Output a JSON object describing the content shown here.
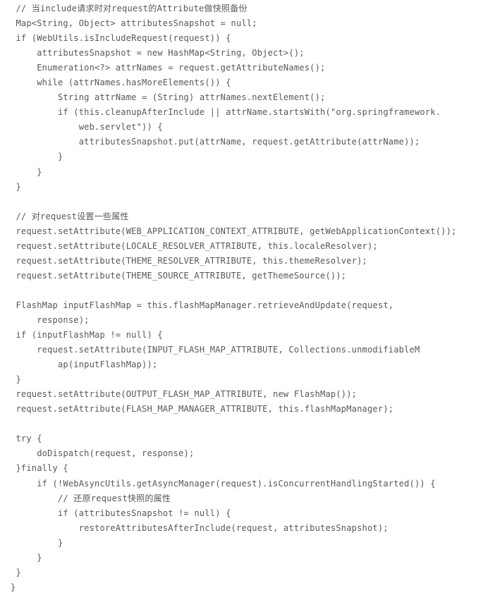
{
  "document": {
    "kind": "code-listing",
    "language": "Java",
    "background_color": "#ffffff",
    "text_color": "#55585c",
    "lines": [
      " // 当include请求时对request的Attribute做快照备份",
      " Map<String, Object> attributesSnapshot = null;",
      " if (WebUtils.isIncludeRequest(request)) {",
      "     attributesSnapshot = new HashMap<String, Object>();",
      "     Enumeration<?> attrNames = request.getAttributeNames();",
      "     while (attrNames.hasMoreElements()) {",
      "         String attrName = (String) attrNames.nextElement();",
      "         if (this.cleanupAfterInclude || attrName.startsWith(\"org.springframework.",
      "             web.servlet\")) {",
      "             attributesSnapshot.put(attrName, request.getAttribute(attrName));",
      "         }",
      "     }",
      " }",
      "",
      " // 对request设置一些属性",
      " request.setAttribute(WEB_APPLICATION_CONTEXT_ATTRIBUTE, getWebApplicationContext());",
      " request.setAttribute(LOCALE_RESOLVER_ATTRIBUTE, this.localeResolver);",
      " request.setAttribute(THEME_RESOLVER_ATTRIBUTE, this.themeResolver);",
      " request.setAttribute(THEME_SOURCE_ATTRIBUTE, getThemeSource());",
      "",
      " FlashMap inputFlashMap = this.flashMapManager.retrieveAndUpdate(request,",
      "     response);",
      " if (inputFlashMap != null) {",
      "     request.setAttribute(INPUT_FLASH_MAP_ATTRIBUTE, Collections.unmodifiableM",
      "         ap(inputFlashMap));",
      " }",
      " request.setAttribute(OUTPUT_FLASH_MAP_ATTRIBUTE, new FlashMap());",
      " request.setAttribute(FLASH_MAP_MANAGER_ATTRIBUTE, this.flashMapManager);",
      "",
      " try {",
      "     doDispatch(request, response);",
      " }finally {",
      "     if (!WebAsyncUtils.getAsyncManager(request).isConcurrentHandlingStarted()) {",
      "         // 还原request快照的属性",
      "         if (attributesSnapshot != null) {",
      "             restoreAttributesAfterInclude(request, attributesSnapshot);",
      "         }",
      "     }",
      " }",
      "}"
    ],
    "comments": [
      "// 当include请求时对request的Attribute做快照备份",
      "// 对request设置一些属性",
      "// 还原request快照的属性"
    ],
    "identifiers": [
      "Map",
      "String",
      "Object",
      "attributesSnapshot",
      "null",
      "WebUtils",
      "isIncludeRequest",
      "request",
      "HashMap",
      "Enumeration",
      "attrNames",
      "getAttributeNames",
      "hasMoreElements",
      "attrName",
      "nextElement",
      "this.cleanupAfterInclude",
      "startsWith",
      "org.springframework.web.servlet",
      "put",
      "getAttribute",
      "setAttribute",
      "WEB_APPLICATION_CONTEXT_ATTRIBUTE",
      "getWebApplicationContext",
      "LOCALE_RESOLVER_ATTRIBUTE",
      "this.localeResolver",
      "THEME_RESOLVER_ATTRIBUTE",
      "this.themeResolver",
      "THEME_SOURCE_ATTRIBUTE",
      "getThemeSource",
      "FlashMap",
      "inputFlashMap",
      "this.flashMapManager",
      "retrieveAndUpdate",
      "response",
      "INPUT_FLASH_MAP_ATTRIBUTE",
      "Collections.unmodifiableMap",
      "OUTPUT_FLASH_MAP_ATTRIBUTE",
      "FLASH_MAP_MANAGER_ATTRIBUTE",
      "try",
      "doDispatch",
      "finally",
      "WebAsyncUtils",
      "getAsyncManager",
      "isConcurrentHandlingStarted",
      "restoreAttributesAfterInclude"
    ]
  }
}
